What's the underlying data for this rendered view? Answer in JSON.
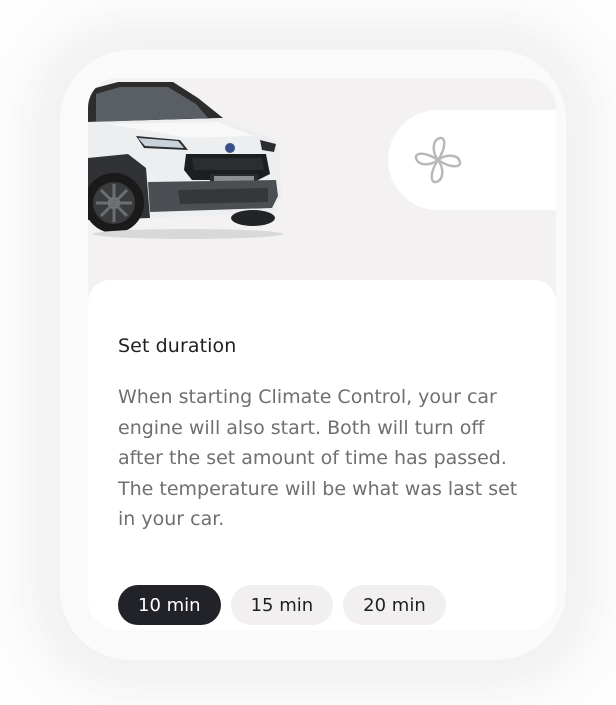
{
  "hero": {
    "image": "car-image",
    "control_icon": "fan-icon"
  },
  "section": {
    "title": "Set duration",
    "description": "When starting Climate Control, your car engine will also start. Both will turn off after the set amount of time has passed. The temperature will be what was last set in your car."
  },
  "duration_options": [
    {
      "label": "10 min",
      "selected": true
    },
    {
      "label": "15 min",
      "selected": false
    },
    {
      "label": "20 min",
      "selected": false
    }
  ],
  "colors": {
    "card_bg": "#f3f1f2",
    "selected_chip": "#222328",
    "chip_bg": "#f1eff0",
    "text_primary": "#1f1f1f",
    "text_secondary": "#6f6f6f"
  }
}
